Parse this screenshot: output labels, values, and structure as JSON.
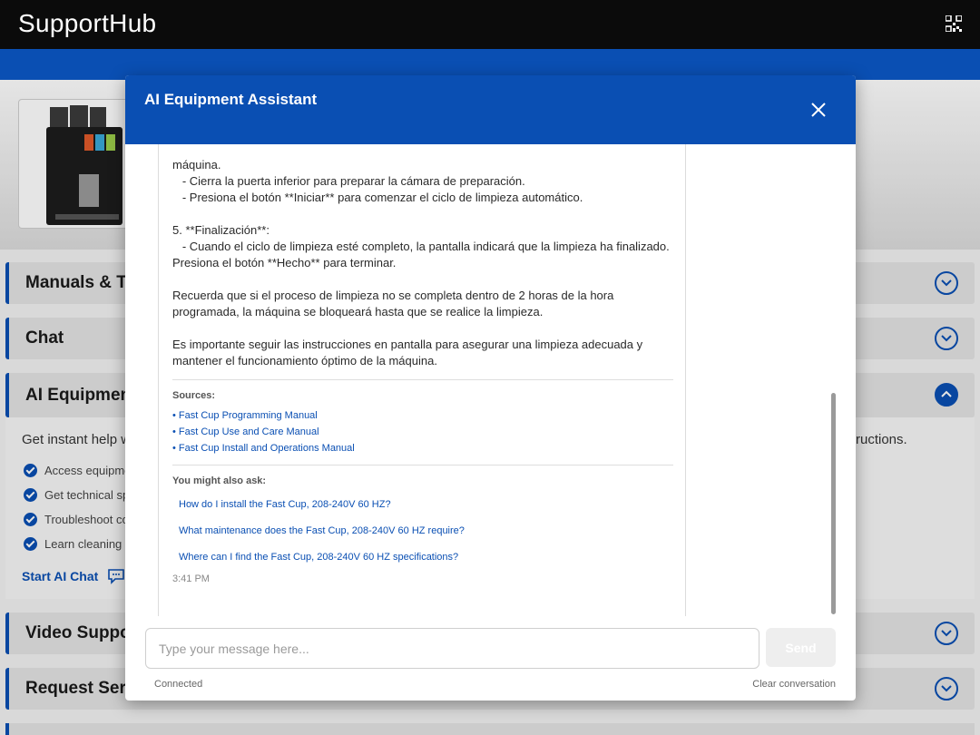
{
  "app": {
    "title": "SupportHub"
  },
  "page": {
    "accordions": [
      {
        "title": "Manuals & Tu",
        "expanded": false
      },
      {
        "title": "Chat",
        "expanded": false
      },
      {
        "title": "AI Equipment",
        "expanded": true
      },
      {
        "title": "Video Suppor",
        "expanded": false
      },
      {
        "title": "Request Servi",
        "expanded": false
      }
    ],
    "ai_section": {
      "intro_left": "Get instant help w",
      "intro_right": "ructions.",
      "features": [
        "Access equipme",
        "Get technical sp",
        "Troubleshoot co",
        "Learn cleaning a"
      ],
      "start_chat": "Start AI Chat"
    }
  },
  "modal": {
    "title": "AI Equipment Assistant",
    "message": {
      "lines": [
        "máquina.",
        "   - Cierra la puerta inferior para preparar la cámara de preparación.",
        "   - Presiona el botón **Iniciar** para comenzar el ciclo de limpieza automático.",
        "",
        "5. **Finalización**:",
        "   - Cuando el ciclo de limpieza esté completo, la pantalla indicará que la limpieza ha finalizado.",
        "Presiona el botón **Hecho** para terminar.",
        "",
        "Recuerda que si el proceso de limpieza no se completa dentro de 2 horas de la hora",
        "programada, la máquina se bloqueará hasta que se realice la limpieza.",
        "",
        "Es importante seguir las instrucciones en pantalla para asegurar una limpieza adecuada y",
        "mantener el funcionamiento óptimo de la máquina."
      ],
      "sources_label": "Sources:",
      "sources": [
        "• Fast Cup Programming Manual",
        "• Fast Cup Use and Care Manual",
        "• Fast Cup Install and Operations Manual"
      ],
      "suggestions_label": "You might also ask:",
      "suggestions": [
        "How do I install the Fast Cup, 208-240V 60 HZ?",
        "What maintenance does the Fast Cup, 208-240V 60 HZ require?",
        "Where can I find the Fast Cup, 208-240V 60 HZ specifications?"
      ],
      "time": "3:41 PM"
    },
    "input": {
      "placeholder": "Type your message here...",
      "value": ""
    },
    "send_label": "Send",
    "status": "Connected",
    "clear_label": "Clear conversation"
  },
  "colors": {
    "brand_blue": "#0a4fb3",
    "top_bar": "#0b0b0b"
  },
  "icons": {
    "close": "close-icon",
    "qr": "qr-code-icon",
    "chevron": "chevron-icon",
    "chat": "chat-bubble-icon",
    "check": "check-icon"
  }
}
